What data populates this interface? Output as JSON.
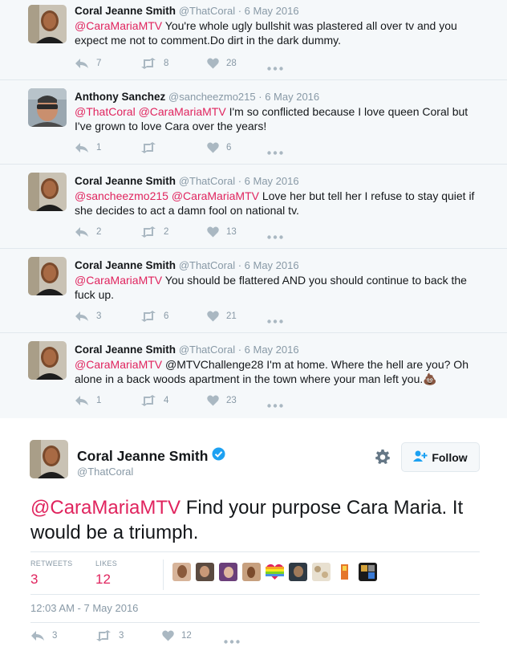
{
  "replies": [
    {
      "name": "Coral Jeanne Smith",
      "handle": "@ThatCoral",
      "date": "6 May 2016",
      "mention": "@CaraMariaMTV",
      "text": " You're whole ugly bullshit was plastered all over tv and you expect me not to comment.Do dirt in the dark dummy.",
      "replies": "7",
      "retweets": "8",
      "likes": "28",
      "avatar": "coral"
    },
    {
      "name": "Anthony Sanchez",
      "handle": "@sancheezmo215",
      "date": "6 May 2016",
      "mention": "@ThatCoral @CaraMariaMTV",
      "text": " I'm so conflicted because I love queen Coral but I've grown to love Cara over the years!",
      "replies": "1",
      "retweets": "",
      "likes": "6",
      "avatar": "anthony"
    },
    {
      "name": "Coral Jeanne Smith",
      "handle": "@ThatCoral",
      "date": "6 May 2016",
      "mention": "@sancheezmo215 @CaraMariaMTV",
      "text": " Love her but tell her I refuse to stay quiet if she decides to act a damn fool on national tv.",
      "replies": "2",
      "retweets": "2",
      "likes": "13",
      "avatar": "coral"
    },
    {
      "name": "Coral Jeanne Smith",
      "handle": "@ThatCoral",
      "date": "6 May 2016",
      "mention": "@CaraMariaMTV",
      "text": " You should be flattered AND you should continue to back the fuck up.",
      "replies": "3",
      "retweets": "6",
      "likes": "21",
      "avatar": "coral"
    },
    {
      "name": "Coral Jeanne Smith",
      "handle": "@ThatCoral",
      "date": "6 May 2016",
      "mention": "@CaraMariaMTV",
      "text": " @MTVChallenge28 I'm at home. Where the hell are you? Oh alone in a back woods apartment in the town where your man left you.💩",
      "replies": "1",
      "retweets": "4",
      "likes": "23",
      "avatar": "coral"
    }
  ],
  "main_tweet": {
    "name": "Coral Jeanne Smith",
    "handle": "@ThatCoral",
    "follow_label": "Follow",
    "mention": "@CaraMariaMTV",
    "text": " Find your purpose Cara Maria. It would be a triumph.",
    "retweets_label": "RETWEETS",
    "retweets": "3",
    "likes_label": "LIKES",
    "likes": "12",
    "timestamp": "12:03 AM - 7 May 2016",
    "action_replies": "3",
    "action_retweets": "3",
    "action_likes": "12"
  },
  "colors": {
    "mention": "#e0245e",
    "muted": "#8899a6",
    "icon": "#aab8c2",
    "verified": "#1da1f2"
  }
}
